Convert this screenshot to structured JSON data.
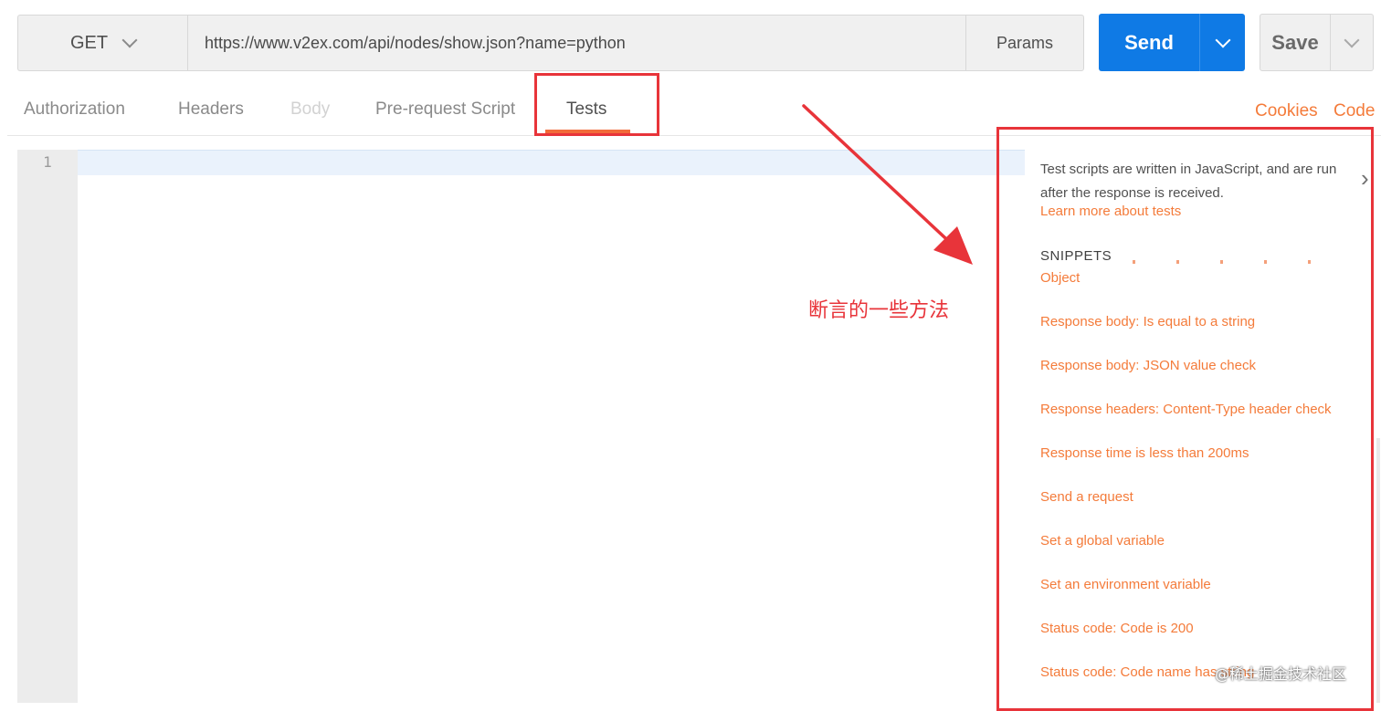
{
  "request": {
    "method": "GET",
    "url": "https://www.v2ex.com/api/nodes/show.json?name=python",
    "params_label": "Params",
    "send_label": "Send",
    "save_label": "Save"
  },
  "tabs": [
    {
      "label": "Authorization",
      "state": "normal"
    },
    {
      "label": "Headers",
      "state": "normal"
    },
    {
      "label": "Body",
      "state": "disabled"
    },
    {
      "label": "Pre-request Script",
      "state": "normal"
    },
    {
      "label": "Tests",
      "state": "active"
    }
  ],
  "links": {
    "cookies": "Cookies",
    "code": "Code"
  },
  "editor": {
    "line_number": "1"
  },
  "snippets_panel": {
    "description": "Test scripts are written in JavaScript, and are run after the response is received.",
    "learn_more": "Learn more about tests",
    "title": "SNIPPETS",
    "items": [
      "Object",
      "Response body: Is equal to a string",
      "Response body: JSON value check",
      "Response headers: Content-Type header check",
      "Response time is less than 200ms",
      "Send a request",
      "Set a global variable",
      "Set an environment variable",
      "Status code: Code is 200",
      "Status code: Code name has string"
    ]
  },
  "annotation": {
    "text": "断言的一些方法"
  },
  "watermark": "@稀土掘金技术社区",
  "colors": {
    "accent": "#f47b3a",
    "send_blue": "#0f7ae5",
    "annotation_red": "#e8343a"
  }
}
